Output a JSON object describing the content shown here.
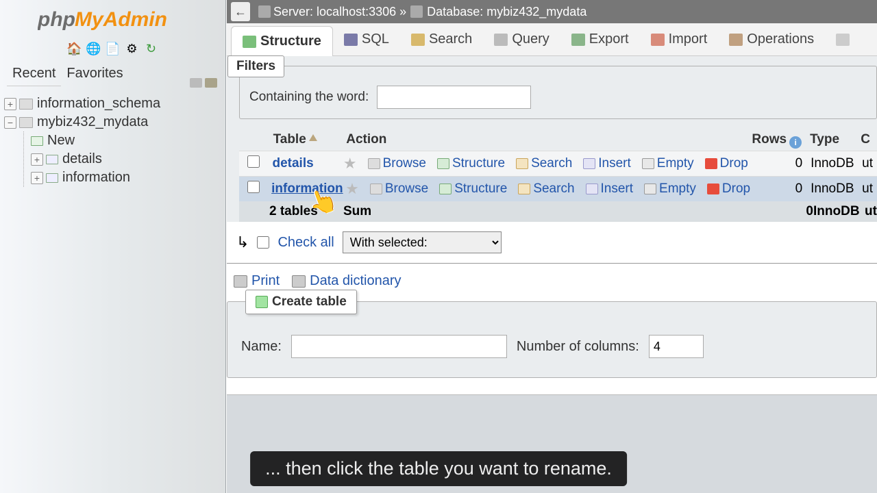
{
  "logo_alt": "phpMyAdmin",
  "sidebar": {
    "tabs": {
      "recent": "Recent",
      "favorites": "Favorites"
    },
    "tree": {
      "db1": "information_schema",
      "db2": "mybiz432_mydata",
      "new": "New",
      "tbl1": "details",
      "tbl2": "information"
    }
  },
  "breadcrumb": {
    "server_label": "Server:",
    "server_value": "localhost:3306",
    "sep": "»",
    "db_label": "Database:",
    "db_value": "mybiz432_mydata"
  },
  "tabs": {
    "structure": "Structure",
    "sql": "SQL",
    "search": "Search",
    "query": "Query",
    "export": "Export",
    "import": "Import",
    "operations": "Operations"
  },
  "filters": {
    "box_label": "Filters",
    "containing": "Containing the word:",
    "value": ""
  },
  "table": {
    "headers": {
      "table": "Table",
      "action": "Action",
      "rows": "Rows",
      "type": "Type",
      "collation": "C"
    },
    "actions": {
      "browse": "Browse",
      "structure": "Structure",
      "search": "Search",
      "insert": "Insert",
      "empty": "Empty",
      "drop": "Drop"
    },
    "rows": [
      {
        "name": "details",
        "rows": "0",
        "type": "InnoDB",
        "coll_prefix": "ut"
      },
      {
        "name": "information",
        "rows": "0",
        "type": "InnoDB",
        "coll_prefix": "ut"
      }
    ],
    "summary": {
      "count": "2 tables",
      "sum": "Sum",
      "rows": "0",
      "type": "InnoDB",
      "coll_prefix": "ut"
    }
  },
  "checkall": {
    "label": "Check all",
    "with_selected": "With selected:"
  },
  "links": {
    "print": "Print",
    "data_dict": "Data dictionary"
  },
  "create": {
    "box_label": "Create table",
    "name_label": "Name:",
    "name_value": "",
    "cols_label": "Number of columns:",
    "cols_value": "4"
  },
  "caption": "... then click the table you want to rename."
}
